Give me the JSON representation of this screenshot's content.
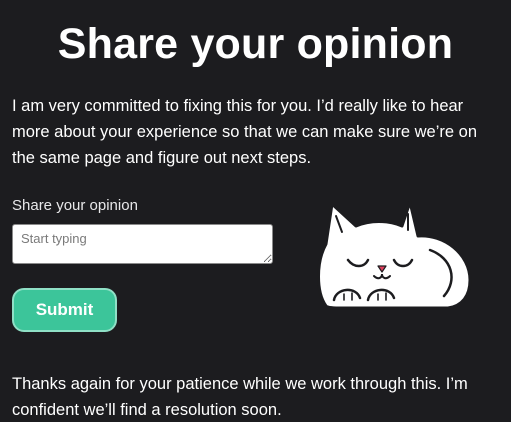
{
  "page": {
    "title": "Share your opinion",
    "intro": "I am very committed to fixing this for you. I’d really like to hear more about your experience so that we can make sure we’re on the same page and figure out next steps.",
    "outro": "Thanks again for your patience while we work through this. I’m confident we’ll find a resolution soon."
  },
  "form": {
    "label": "Share your opinion",
    "placeholder": "Start typing",
    "value": "",
    "submit_label": "Submit"
  },
  "illustration": {
    "icon": "sleeping-cat-icon"
  },
  "colors": {
    "background": "#1c1c1f",
    "text": "#ffffff",
    "button": "#3cc59a",
    "button_border": "#8fe0c6",
    "cat_nose": "#e0405e"
  }
}
